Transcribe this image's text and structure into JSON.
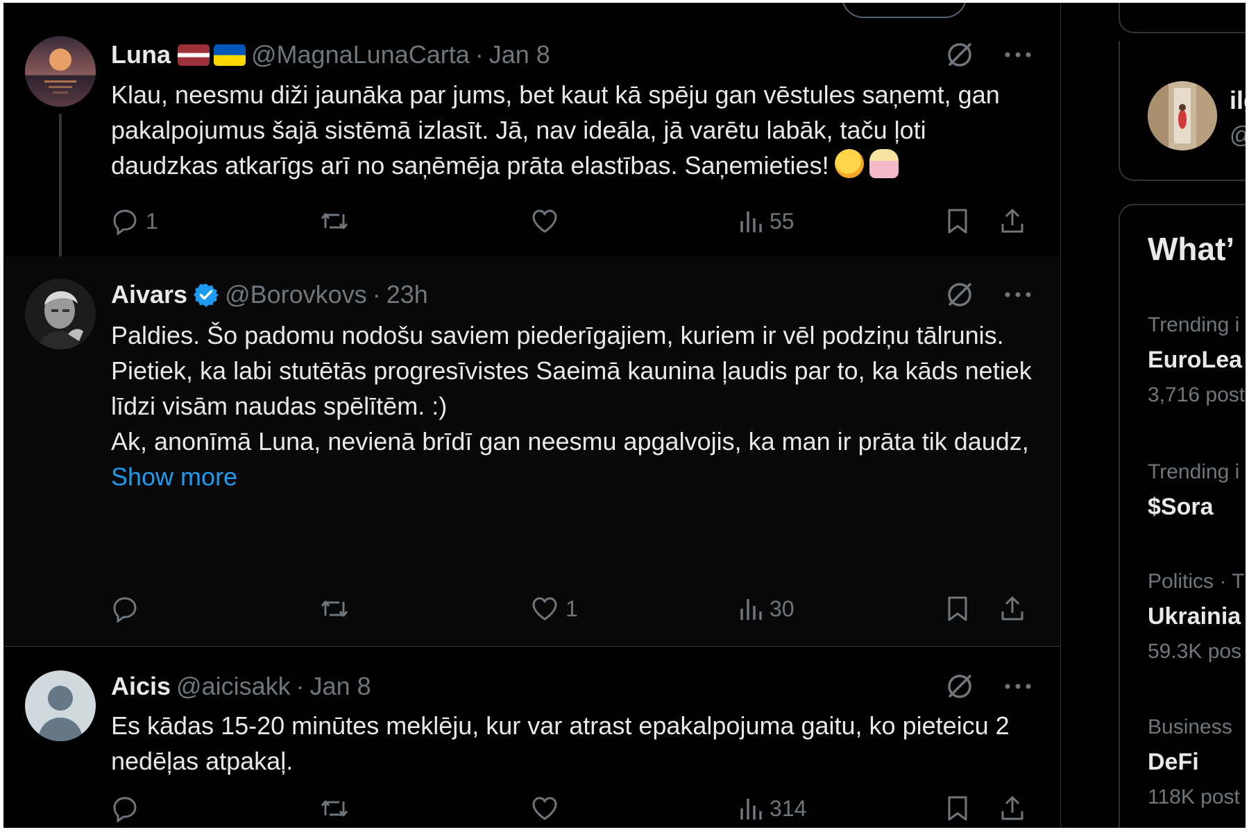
{
  "tweets": [
    {
      "name": "Luna",
      "handle": "@MagnaLunaCarta",
      "time": "Jan 8",
      "body": [
        "Klau, neesmu diži jaunāka par jums, bet kaut kā spēju gan vēstules saņemt, gan pakalpojumus šajā sistēmā izlasīt. Jā, nav ideāla, jā varētu labāk, taču ļoti daudzkas atkarīgs arī no saņēmēja prāta elastības. Saņemieties!"
      ],
      "flags": [
        "latvia-flag",
        "ukraine-flag"
      ],
      "emojis": [
        "face-with-hand-over-mouth",
        "person-shrugging"
      ],
      "stats": {
        "replies": "1",
        "retweets": "",
        "likes": "",
        "views": "55"
      }
    },
    {
      "name": "Aivars",
      "handle": "@Borovkovs",
      "time": "23h",
      "verified": true,
      "body": [
        "Paldies. Šo padomu nodošu saviem piederīgajiem, kuriem ir vēl podziņu tālrunis.",
        "Pietiek, ka labi stutētās progresīvistes Saeimā kaunina ļaudis par to, ka kāds netiek līdzi visām naudas spēlītēm. :)",
        "Ak, anonīmā Luna, nevienā brīdī gan neesmu apgalvojis, ka man ir prāta tik daudz,"
      ],
      "show_more": "Show more",
      "stats": {
        "replies": "",
        "retweets": "",
        "likes": "1",
        "views": "30"
      }
    },
    {
      "name": "Aicis",
      "handle": "@aicisakk",
      "time": "Jan 8",
      "body": [
        "Es kādas 15-20 minūtes meklēju, kur var atrast epakalpojuma gaitu, ko pieteicu 2 nedēļas atpakaļ."
      ],
      "stats": {
        "replies": "",
        "retweets": "",
        "likes": "",
        "views": "314"
      }
    }
  ],
  "sidebar": {
    "who_to_follow": {
      "name": "ilg",
      "handle": "@"
    },
    "trends_title": "What’",
    "trends": [
      {
        "category": "Trending i",
        "name": "EuroLea",
        "posts": "3,716 post"
      },
      {
        "category": "Trending i",
        "name": "$Sora",
        "posts": ""
      },
      {
        "category": "Politics · T",
        "name": "Ukrainia",
        "posts": "59.3K pos"
      },
      {
        "category": "Business",
        "name": "DeFi",
        "posts": "118K post"
      }
    ]
  },
  "colors": {
    "background": "#000000",
    "text": "#e7e9ea",
    "muted": "#71767b",
    "accent": "#1d9bf0",
    "border": "#2f3336"
  }
}
